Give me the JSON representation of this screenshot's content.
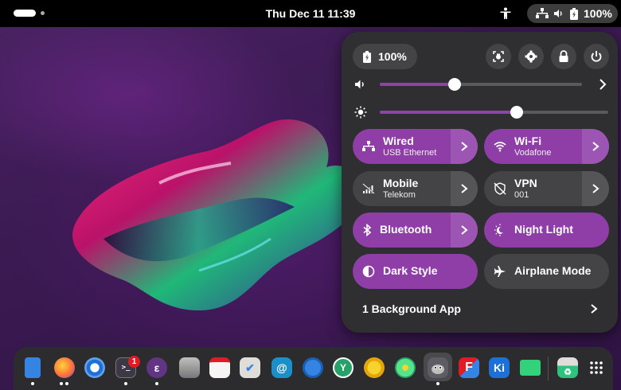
{
  "topbar": {
    "clock": "Thu Dec 11  11:39",
    "battery_percent": "100%"
  },
  "quick_settings": {
    "battery_label": "100%",
    "volume_level": 0.37,
    "brightness_level": 0.6,
    "tiles": {
      "wired": {
        "title": "Wired",
        "subtitle": "USB Ethernet"
      },
      "wifi": {
        "title": "Wi-Fi",
        "subtitle": "Vodafone"
      },
      "mobile": {
        "title": "Mobile",
        "subtitle": "Telekom"
      },
      "vpn": {
        "title": "VPN",
        "subtitle": "001"
      },
      "bluetooth": {
        "title": "Bluetooth"
      },
      "night_light": {
        "title": "Night Light"
      },
      "dark_style": {
        "title": "Dark Style"
      },
      "airplane_mode": {
        "title": "Airplane Mode"
      }
    },
    "background_apps": "1 Background App"
  },
  "dock": {
    "terminal_badge": "1",
    "kiwix_label": "Ki"
  },
  "colors": {
    "accent": "#8e3ea6",
    "panel": "#2f2f31",
    "tile_off": "#444446"
  }
}
